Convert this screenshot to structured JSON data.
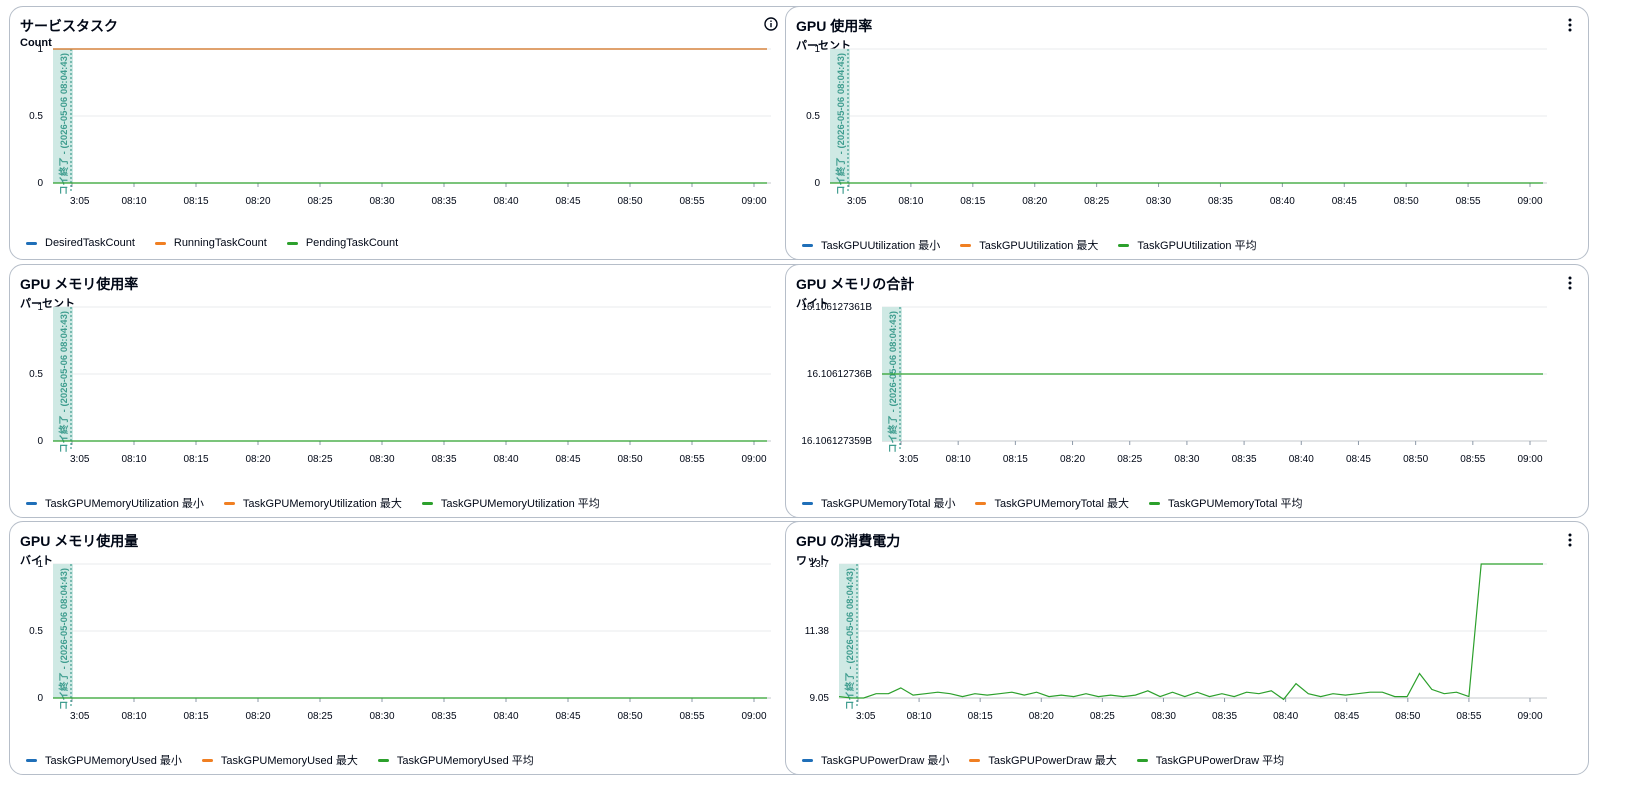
{
  "colors": {
    "blue": "#1f6fb8",
    "orange": "#f07f22",
    "green": "#2ca02c",
    "annotation": "#3f9d8f",
    "annotation_band": "#cfe9e4",
    "grid": "#e9ebed"
  },
  "x_ticks": [
    "3:05",
    "08:10",
    "08:15",
    "08:20",
    "08:25",
    "08:30",
    "08:35",
    "08:40",
    "08:45",
    "08:50",
    "08:55",
    "09:00"
  ],
  "annotation_label": "コイ終了 - (2026-05-06 08:04:43)",
  "widgets": [
    {
      "title": "サービスタスク",
      "unit": "Count",
      "has_info": true,
      "y_ticks": [
        "1",
        "0.5",
        "0"
      ],
      "legend": [
        {
          "label": "DesiredTaskCount",
          "color": "#1f6fb8"
        },
        {
          "label": "RunningTaskCount",
          "color": "#f07f22"
        },
        {
          "label": "PendingTaskCount",
          "color": "#2ca02c"
        }
      ]
    },
    {
      "title": "GPU 使用率",
      "unit": "パーセント",
      "has_info": false,
      "y_ticks": [
        "1",
        "0.5",
        "0"
      ],
      "legend": [
        {
          "label": "TaskGPUUtilization 最小",
          "color": "#1f6fb8"
        },
        {
          "label": "TaskGPUUtilization 最大",
          "color": "#f07f22"
        },
        {
          "label": "TaskGPUUtilization 平均",
          "color": "#2ca02c"
        }
      ]
    },
    {
      "title": "GPU メモリ使用率",
      "unit": "パーセント",
      "has_info": false,
      "y_ticks": [
        "1",
        "0.5",
        "0"
      ],
      "legend": [
        {
          "label": "TaskGPUMemoryUtilization 最小",
          "color": "#1f6fb8"
        },
        {
          "label": "TaskGPUMemoryUtilization 最大",
          "color": "#f07f22"
        },
        {
          "label": "TaskGPUMemoryUtilization 平均",
          "color": "#2ca02c"
        }
      ]
    },
    {
      "title": "GPU メモリの合計",
      "unit": "バイト",
      "has_info": false,
      "y_ticks": [
        "16.106127361B",
        "16.10612736B",
        "16.106127359B"
      ],
      "legend": [
        {
          "label": "TaskGPUMemoryTotal 最小",
          "color": "#1f6fb8"
        },
        {
          "label": "TaskGPUMemoryTotal 最大",
          "color": "#f07f22"
        },
        {
          "label": "TaskGPUMemoryTotal 平均",
          "color": "#2ca02c"
        }
      ]
    },
    {
      "title": "GPU メモリ使用量",
      "unit": "バイト",
      "has_info": false,
      "y_ticks": [
        "1",
        "0.5",
        "0"
      ],
      "legend": [
        {
          "label": "TaskGPUMemoryUsed 最小",
          "color": "#1f6fb8"
        },
        {
          "label": "TaskGPUMemoryUsed 最大",
          "color": "#f07f22"
        },
        {
          "label": "TaskGPUMemoryUsed 平均",
          "color": "#2ca02c"
        }
      ]
    },
    {
      "title": "GPU の消費電力",
      "unit": "ワット",
      "has_info": false,
      "y_ticks": [
        "13.7",
        "11.38",
        "9.05"
      ],
      "legend": [
        {
          "label": "TaskGPUPowerDraw 最小",
          "color": "#1f6fb8"
        },
        {
          "label": "TaskGPUPowerDraw 最大",
          "color": "#f07f22"
        },
        {
          "label": "TaskGPUPowerDraw 平均",
          "color": "#2ca02c"
        }
      ]
    }
  ],
  "chart_data": [
    {
      "type": "line",
      "title": "サービスタスク",
      "ylabel": "Count",
      "ylim": [
        0,
        1
      ],
      "series": [
        {
          "name": "DesiredTaskCount",
          "values": [
            1,
            1
          ]
        },
        {
          "name": "RunningTaskCount",
          "values": [
            1,
            1
          ]
        },
        {
          "name": "PendingTaskCount",
          "values": [
            0,
            0
          ]
        }
      ]
    },
    {
      "type": "line",
      "title": "GPU 使用率",
      "ylabel": "パーセント",
      "ylim": [
        0,
        1
      ],
      "series": [
        {
          "name": "TaskGPUUtilization 平均",
          "values": [
            0,
            0
          ]
        }
      ]
    },
    {
      "type": "line",
      "title": "GPU メモリ使用率",
      "ylabel": "パーセント",
      "ylim": [
        0,
        1
      ],
      "series": [
        {
          "name": "TaskGPUMemoryUtilization 平均",
          "values": [
            0,
            0
          ]
        }
      ]
    },
    {
      "type": "line",
      "title": "GPU メモリの合計",
      "ylabel": "バイト",
      "series": [
        {
          "name": "TaskGPUMemoryTotal 平均",
          "values": [
            16.10612736,
            16.10612736
          ]
        }
      ]
    },
    {
      "type": "line",
      "title": "GPU メモリ使用量",
      "ylabel": "バイト",
      "ylim": [
        0,
        1
      ],
      "series": [
        {
          "name": "TaskGPUMemoryUsed 平均",
          "values": [
            0,
            0
          ]
        }
      ]
    },
    {
      "type": "line",
      "title": "GPU の消費電力",
      "ylabel": "ワット",
      "ylim": [
        9.05,
        13.7
      ],
      "series": [
        {
          "name": "TaskGPUPowerDraw 平均",
          "values": [
            9.1,
            9.05,
            9.05,
            9.2,
            9.2,
            9.4,
            9.15,
            9.2,
            9.25,
            9.2,
            9.1,
            9.2,
            9.15,
            9.2,
            9.25,
            9.15,
            9.25,
            9.1,
            9.15,
            9.1,
            9.2,
            9.1,
            9.15,
            9.1,
            9.15,
            9.3,
            9.1,
            9.25,
            9.1,
            9.25,
            9.1,
            9.2,
            9.1,
            9.25,
            9.2,
            9.3,
            9.0,
            9.55,
            9.2,
            9.1,
            9.2,
            9.15,
            9.2,
            9.25,
            9.25,
            9.1,
            9.1,
            9.9,
            9.35,
            9.2,
            9.25,
            9.1,
            13.7,
            13.7,
            13.7,
            13.7,
            13.7,
            13.7
          ]
        }
      ]
    }
  ]
}
